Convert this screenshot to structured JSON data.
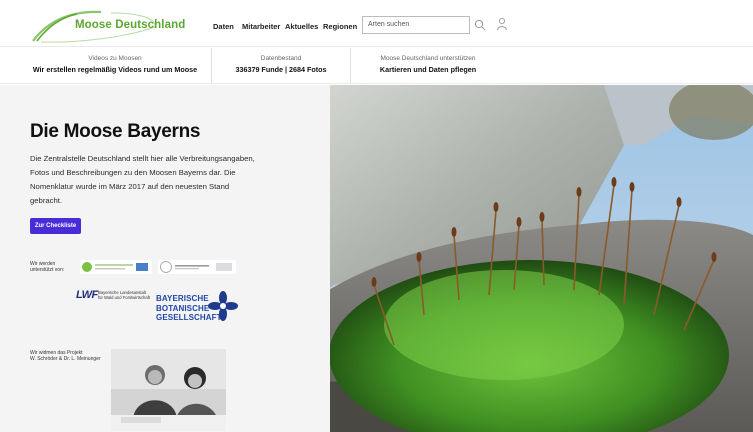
{
  "header": {
    "logo_text": "Moose Deutschland",
    "nav": [
      "Daten",
      "Mitarbeiter",
      "Aktuelles",
      "Regionen"
    ],
    "search_placeholder": "Arten suchen",
    "search_icon": "search-icon",
    "user_icon": "user-icon"
  },
  "infobar": [
    {
      "small": "Videos zu Moosen",
      "big": "Wir erstellen regelmäßig Videos rund um Moose"
    },
    {
      "small": "Datenbestand",
      "big": "336379 Funde | 2684 Fotos"
    },
    {
      "small": "Moose Deutschland unterstützen",
      "big": "Kartieren und Daten pflegen"
    }
  ],
  "main": {
    "title": "Die Moose Bayerns",
    "description": "Die Zentralstelle Deutschland stellt hier alle Verbreitungsangaben, Fotos und Beschreibungen zu den Moosen Bayerns dar. Die Nomenklatur wurde im März 2017 auf den neuesten Stand gebracht.",
    "button_label": "Zur Checkliste",
    "supported_by": "Wir werden unterstützt von:",
    "lwf": {
      "mark": "LWF",
      "text_line1": "Bayerische Landesanstalt",
      "text_line2": "für Wald und Forstwirtschaft"
    },
    "bbg": {
      "line1": "BAYERISCHE",
      "line2": "BOTANISCHE",
      "line3": "GESELLSCHAFT"
    },
    "dedication_line1": "Wir widmen das Projekt",
    "dedication_line2": "W. Schröder & Dr. L. Meinunger"
  },
  "colors": {
    "brand_green": "#5aa832",
    "button_purple": "#4a2bd8",
    "bbg_blue": "#1f46a5"
  }
}
